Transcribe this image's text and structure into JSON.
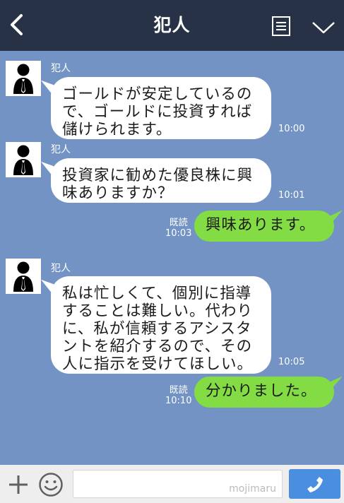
{
  "header": {
    "title": "犯人"
  },
  "messages": [
    {
      "sender": "犯人",
      "text": "ゴールドが安定しているの\nで、ゴールドに投資すれば\n儲けられます。",
      "time": "10:00"
    },
    {
      "sender": "犯人",
      "text": "投資家に勧めた優良株に興\n味ありますか？",
      "time": "10:01"
    },
    {
      "read": "既読",
      "text": "興味あります。",
      "time": "10:03"
    },
    {
      "sender": "犯人",
      "text": "私は忙しくて、個別に指導\nすることは難しい。代わり\nに、私が信頼するアシスタ\nントを紹介するので、その\n人に指示を受けてほしい。",
      "time": "10:05"
    },
    {
      "read": "既読",
      "text": "分かりました。",
      "time": "10:10"
    }
  ],
  "input": {
    "watermark": "mojimaru"
  },
  "colors": {
    "header": "#273246",
    "background": "#7293c4",
    "incoming": "#ffffff",
    "outgoing": "#83dc44",
    "call": "#4a8ee0"
  },
  "icons": {
    "back": "back-chevron-icon",
    "menu": "list-menu-icon",
    "more": "chevron-down-icon",
    "add": "plus-icon",
    "emoji": "smiley-icon",
    "call": "phone-icon"
  }
}
